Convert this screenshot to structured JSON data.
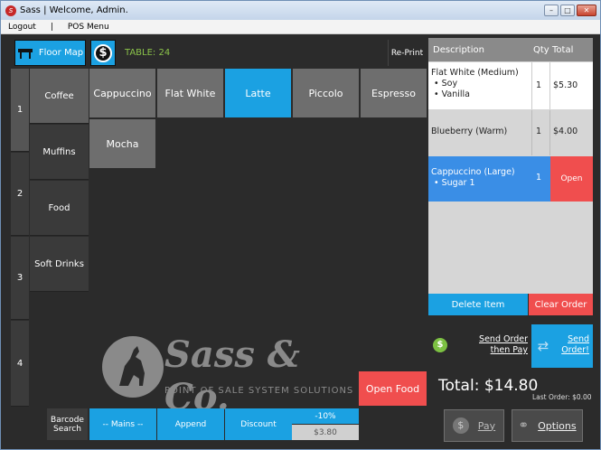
{
  "window": {
    "title": "Sass | Welcome, Admin."
  },
  "menu": {
    "items": [
      "Logout",
      "|",
      "POS Menu"
    ]
  },
  "header": {
    "floor_map": "Floor Map",
    "table": "TABLE: 24",
    "reprint": "Re-Print"
  },
  "sidebar": {
    "numbers": [
      "1",
      "2",
      "3",
      "4"
    ],
    "categories": [
      "Coffee",
      "Muffins",
      "Food",
      "Soft Drinks"
    ]
  },
  "products": [
    "Cappuccino",
    "Flat White",
    "Latte",
    "Piccolo",
    "Espresso",
    "Mocha"
  ],
  "logo": {
    "brand": "Sass & Co.",
    "tagline": "POINT OF SALE SYSTEM SOLUTIONS"
  },
  "open_food": "Open Food",
  "bottom": {
    "barcode": "Barcode Search",
    "mains": "-- Mains --",
    "append": "Append",
    "discount": "Discount",
    "discount_pct": "-10%",
    "discount_amt": "$3.80"
  },
  "order": {
    "headers": {
      "desc": "Description",
      "qty": "Qty",
      "total": "Total"
    },
    "rows": [
      {
        "name": "Flat White (Medium)",
        "mods": [
          "• Soy",
          "• Vanilla"
        ],
        "qty": "1",
        "total": "$5.30"
      },
      {
        "name": "Blueberry (Warm)",
        "mods": [],
        "qty": "1",
        "total": "$4.00"
      },
      {
        "name": "Cappuccino (Large)",
        "mods": [
          "• Sugar 1"
        ],
        "qty": "1",
        "total": "Open"
      }
    ]
  },
  "actions": {
    "delete": "Delete Item",
    "clear": "Clear Order"
  },
  "send": {
    "pay": "Send Order then Pay",
    "order": "Send Order!"
  },
  "total": {
    "label": "Total: $14.80",
    "last": "Last Order: $0.00"
  },
  "buttons": {
    "pay": "Pay",
    "options": "Options"
  },
  "colors": {
    "accent": "#1ba1e2",
    "danger": "#f04e4e",
    "tableLabel": "#8bc34a"
  }
}
